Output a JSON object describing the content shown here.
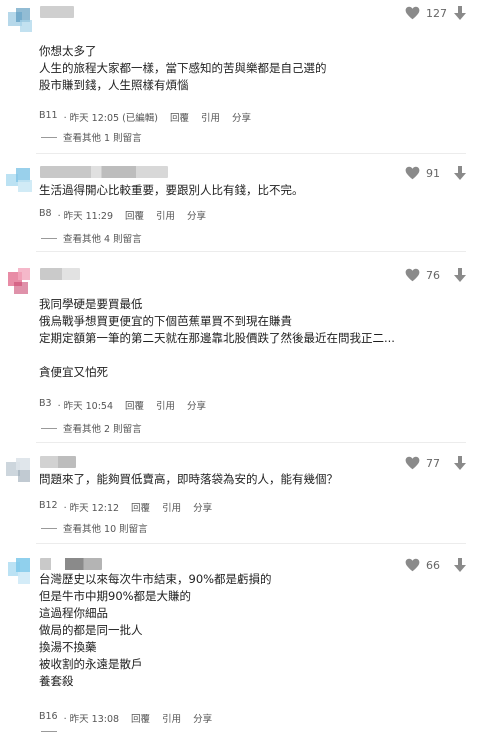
{
  "comments": [
    {
      "likes": "127",
      "lines": [
        "你想太多了",
        "人生的旅程大家都一樣，當下感知的苦與樂都是自己選的",
        "股市賺到錢，人生照樣有煩惱"
      ],
      "floor": "B11",
      "time": "· 昨天 12:05 (已編輯)",
      "reply_label": "回覆",
      "quote_label": "引用",
      "share_label": "分享",
      "more_replies": "查看其他 1 則留言",
      "avatar_color": "#7ab8d8"
    },
    {
      "likes": "91",
      "lines": [
        "生活過得開心比較重要，要跟別人比有錢，比不完。"
      ],
      "floor": "B8",
      "time": "· 昨天 11:29",
      "reply_label": "回覆",
      "quote_label": "引用",
      "share_label": "分享",
      "more_replies": "查看其他 4 則留言",
      "avatar_color": "#7fc4e6"
    },
    {
      "likes": "76",
      "lines": [
        "我同學硬是要買最低",
        "俄烏戰爭想買更便宜的下個芭蕉單買不到現在賺貴",
        "定期定額第一筆的第二天就在那邊靠北股價跌了然後最近在問我正二...",
        "",
        "貪便宜又怕死"
      ],
      "floor": "B3",
      "time": "· 昨天 10:54",
      "reply_label": "回覆",
      "quote_label": "引用",
      "share_label": "分享",
      "more_replies": "查看其他 2 則留言",
      "avatar_color": "#e06688"
    },
    {
      "likes": "77",
      "lines": [
        "問題來了，能夠買低賣高，即時落袋為安的人，能有幾個？"
      ],
      "floor": "B12",
      "time": "· 昨天 12:12",
      "reply_label": "回覆",
      "quote_label": "引用",
      "share_label": "分享",
      "more_replies": "查看其他 10 則留言",
      "avatar_color": "#aab6c4"
    },
    {
      "likes": "66",
      "lines": [
        "台灣歷史以來每次牛市結束，90%都是虧損的",
        "但是牛市中期90%都是大賺的",
        "這過程你細品",
        "做局的都是同一批人",
        "換湯不換藥",
        "被收割的永遠是散戶",
        "養套殺"
      ],
      "floor": "B16",
      "time": "· 昨天 13:08",
      "reply_label": "回覆",
      "quote_label": "引用",
      "share_label": "分享",
      "more_replies": "",
      "avatar_color": "#7cc8ea"
    }
  ],
  "colors": {
    "text": "#1e1e1e",
    "meta": "#555555",
    "icon": "#8a8a8a",
    "divider": "#ececec"
  }
}
